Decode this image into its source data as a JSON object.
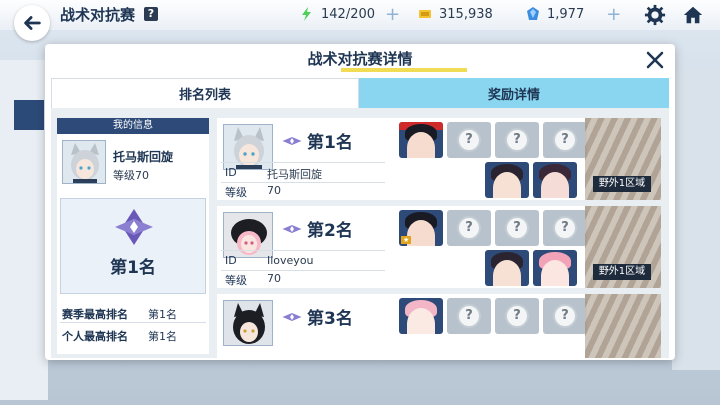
{
  "top": {
    "title": "战术对抗赛",
    "help": "?",
    "ap": "142/200",
    "credits": "315,938",
    "gems": "1,977",
    "plus": "+"
  },
  "dialog": {
    "title": "战术对抗赛详情",
    "tabs": {
      "ranking": "排名列表",
      "rewards": "奖励详情"
    },
    "my_info": {
      "header": "我的信息",
      "name": "托马斯回旋",
      "level": "等级70",
      "rank": "第1名",
      "season_best_label": "赛季最高排名",
      "season_best_value": "第1名",
      "personal_best_label": "个人最高排名",
      "personal_best_value": "第1名"
    },
    "id_label": "ID",
    "level_label": "等级",
    "rows": [
      {
        "rank": "第1名",
        "id": "托马斯回旋",
        "level": "70",
        "area": "野外1区域"
      },
      {
        "rank": "第2名",
        "id": "Iloveyou",
        "level": "70",
        "area": "野外1区域"
      },
      {
        "rank": "第3名",
        "id": "",
        "level": "",
        "area": ""
      }
    ],
    "empty_slot": "?"
  },
  "colors": {
    "accent": "#2d4a78",
    "tab_active_bg": "#ffffff",
    "tab_inactive_bg": "#8ad6f0",
    "title_underline": "#f1dc56"
  }
}
